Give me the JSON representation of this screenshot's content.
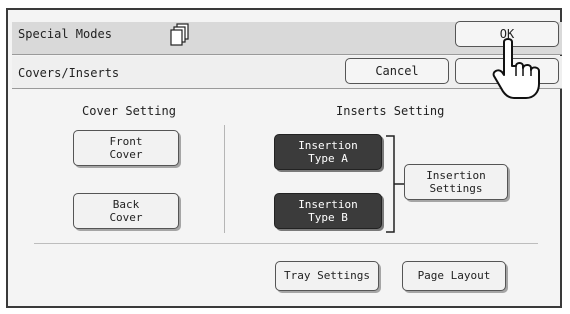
{
  "header": {
    "title": "Special Modes",
    "ok_label": "OK",
    "icon": "copy-stack-icon"
  },
  "subheader": {
    "title": "Covers/Inserts",
    "cancel_label": "Cancel"
  },
  "cover_setting": {
    "title": "Cover Setting",
    "front_cover_label": "Front\nCover",
    "back_cover_label": "Back\nCover"
  },
  "inserts_setting": {
    "title": "Inserts Setting",
    "insertion_type_a_label": "Insertion\nType A",
    "insertion_type_b_label": "Insertion\nType B",
    "insertion_settings_label": "Insertion\nSettings"
  },
  "footer": {
    "tray_settings_label": "Tray Settings",
    "page_layout_label": "Page Layout"
  },
  "colors": {
    "selected_button_bg": "#3b3b3b",
    "button_bg": "#f2f2f2",
    "panel_bg": "#f4f4f4"
  }
}
